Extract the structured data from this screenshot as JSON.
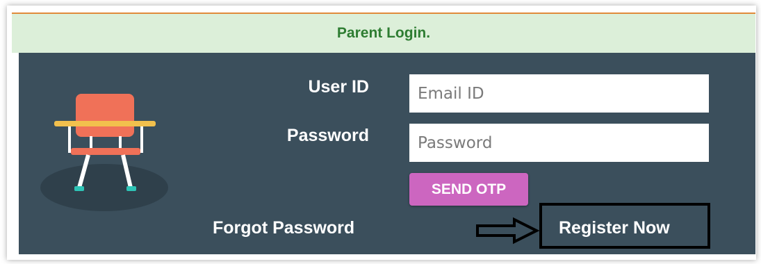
{
  "header": {
    "title": "Parent Login."
  },
  "form": {
    "user_id_label": "User ID",
    "user_id_placeholder": "Email ID",
    "password_label": "Password",
    "password_placeholder": "Password",
    "send_otp_label": "SEND OTP",
    "forgot_password_label": "Forgot Password",
    "register_label": "Register Now"
  },
  "icons": {
    "illustration": "school-chair-icon",
    "annotation": "arrow-right-icon"
  },
  "colors": {
    "header_bg": "#dcefd9",
    "header_text": "#2e7d32",
    "header_border": "#e08a3a",
    "panel_bg": "#3b4f5c",
    "otp_button": "#cc66c0"
  }
}
